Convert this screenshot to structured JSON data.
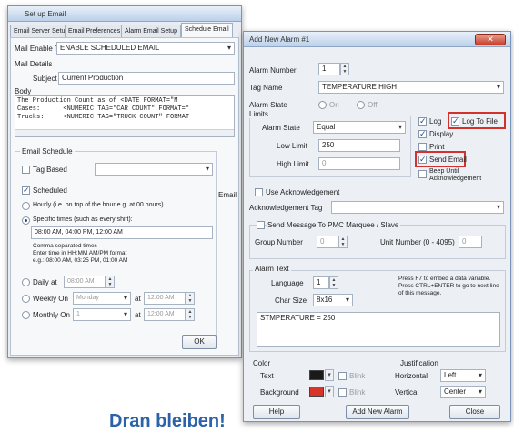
{
  "back_window": {
    "title": "Set up Email",
    "tabs": [
      "Email Server Setup",
      "Email Preferences",
      "Alarm Email Setup",
      "Schedule Email"
    ],
    "mail_enable_label": "Mail Enable Tag",
    "mail_enable_value": "ENABLE SCHEDULED EMAIL",
    "mail_details_label": "Mail Details",
    "subject_label": "Subject",
    "subject_value": "Current Production",
    "body_label": "Body",
    "body_lines": [
      "The Production Count as of <DATE FORMAT=\"M",
      "Cases:      <NUMERIC TAG=\"CAR COUNT\" FORMAT=\"",
      "Trucks:     <NUMERIC TAG=\"TRUCK COUNT\" FORMAT"
    ],
    "email_schedule_label": "Email Schedule",
    "tag_based_label": "Tag Based",
    "scheduled_label": "Scheduled",
    "hourly_label": "Hourly (i.e. on top of the hour e.g. at 00 hours)",
    "specific_times_label": "Specific times (such as every shift):",
    "specific_times_value": "08:00 AM, 04:00 PM, 12:00 AM",
    "hint_line_1": "Comma separated times",
    "hint_line_2": "Enter time in HH:MM AM/PM format",
    "hint_line_3": "e.g.: 08:00 AM, 03:25 PM, 01:00 AM",
    "daily_label": "Daily at",
    "daily_value": "08:00 AM",
    "weekly_label": "Weekly On",
    "weekly_day": "Monday",
    "at_label": "at",
    "weekly_time": "12:00 AM",
    "monthly_label": "Monthly On",
    "monthly_day": "1",
    "monthly_time": "12:00 AM",
    "email_label": "Email",
    "ok_label": "OK"
  },
  "alarm_dialog": {
    "title": "Add New Alarm #1",
    "close_glyph": "✕",
    "alarm_number_label": "Alarm Number",
    "alarm_number_value": "1",
    "tag_name_label": "Tag Name",
    "tag_name_value": "TEMPERATURE HIGH",
    "alarm_state_label": "Alarm State",
    "alarm_state_on": "On",
    "alarm_state_off": "Off",
    "limits_label": "Limits",
    "alarm_state_combo_label": "Alarm State",
    "alarm_state_combo_value": "Equal",
    "low_limit_label": "Low Limit",
    "low_limit_value": "250",
    "high_limit_label": "High Limit",
    "high_limit_value": "0",
    "log_label": "Log",
    "log_to_file_label": "Log To File",
    "display_label": "Display",
    "print_label": "Print",
    "send_email_label": "Send Email",
    "beep_label": "Beep Until Acknowledgement",
    "use_ack_label": "Use Acknowledgement",
    "ack_tag_label": "Acknowledgement Tag",
    "send_message_label": "Send Message To PMC Marquee / Slave",
    "group_number_label": "Group Number",
    "group_number_value": "0",
    "unit_number_label": "Unit Number (0 - 4095)",
    "unit_number_value": "0",
    "alarm_text_label": "Alarm Text",
    "language_label": "Language",
    "language_value": "1",
    "char_size_label": "Char Size",
    "char_size_value": "8x16",
    "hint_text": "Press F7 to embed a data variable. Press CTRL+ENTER to go to next line of this message.",
    "alarm_text_value": "STMPERATURE = 250",
    "color_label": "Color",
    "text_label": "Text",
    "background_label": "Background",
    "blink_label": "Blink",
    "justification_label": "Justification",
    "horizontal_label": "Horizontal",
    "horizontal_value": "Left",
    "vertical_label": "Vertical",
    "vertical_value": "Center",
    "help_label": "Help",
    "add_new_alarm_label": "Add New Alarm",
    "close_label": "Close"
  },
  "headline": "Dran bleiben!",
  "colors": {
    "text_color": "#1a1a1a",
    "background_color": "#d9342a",
    "highlight": "#d3312b",
    "headline": "#2c62a8"
  }
}
